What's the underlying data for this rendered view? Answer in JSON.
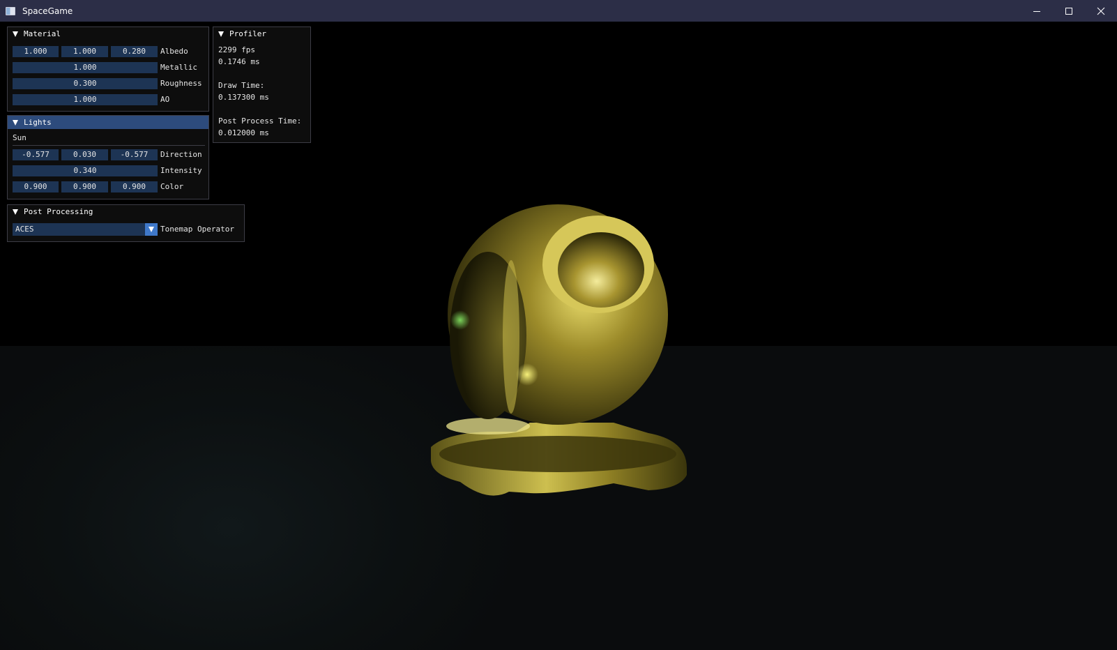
{
  "window": {
    "title": "SpaceGame",
    "controls": [
      "minimize-icon",
      "maximize-icon",
      "close-icon"
    ]
  },
  "material": {
    "header": "Material",
    "albedo": {
      "label": "Albedo",
      "values": [
        "1.000",
        "1.000",
        "0.280"
      ]
    },
    "metallic": {
      "label": "Metallic",
      "value": "1.000"
    },
    "roughness": {
      "label": "Roughness",
      "value": "0.300"
    },
    "ao": {
      "label": "AO",
      "value": "1.000"
    }
  },
  "lights": {
    "header": "Lights",
    "section": "Sun",
    "direction": {
      "label": "Direction",
      "values": [
        "-0.577",
        "0.030",
        "-0.577"
      ]
    },
    "intensity": {
      "label": "Intensity",
      "value": "0.340"
    },
    "color": {
      "label": "Color",
      "values": [
        "0.900",
        "0.900",
        "0.900"
      ]
    }
  },
  "post_processing": {
    "header": "Post Processing",
    "tonemap": {
      "label": "Tonemap Operator",
      "selected": "ACES"
    }
  },
  "profiler": {
    "header": "Profiler",
    "fps": "2299 fps",
    "frame_ms": "0.1746 ms",
    "draw_label": "Draw Time:",
    "draw_value": "0.137300 ms",
    "post_label": "Post Process Time:",
    "post_value": "0.012000 ms"
  },
  "colors": {
    "titlebar": "#2c2e47",
    "field_bg": "#1d3454",
    "header_active": "#2d4b7c",
    "combo_button": "#3f78c9",
    "gold_material": "#b8a236"
  }
}
